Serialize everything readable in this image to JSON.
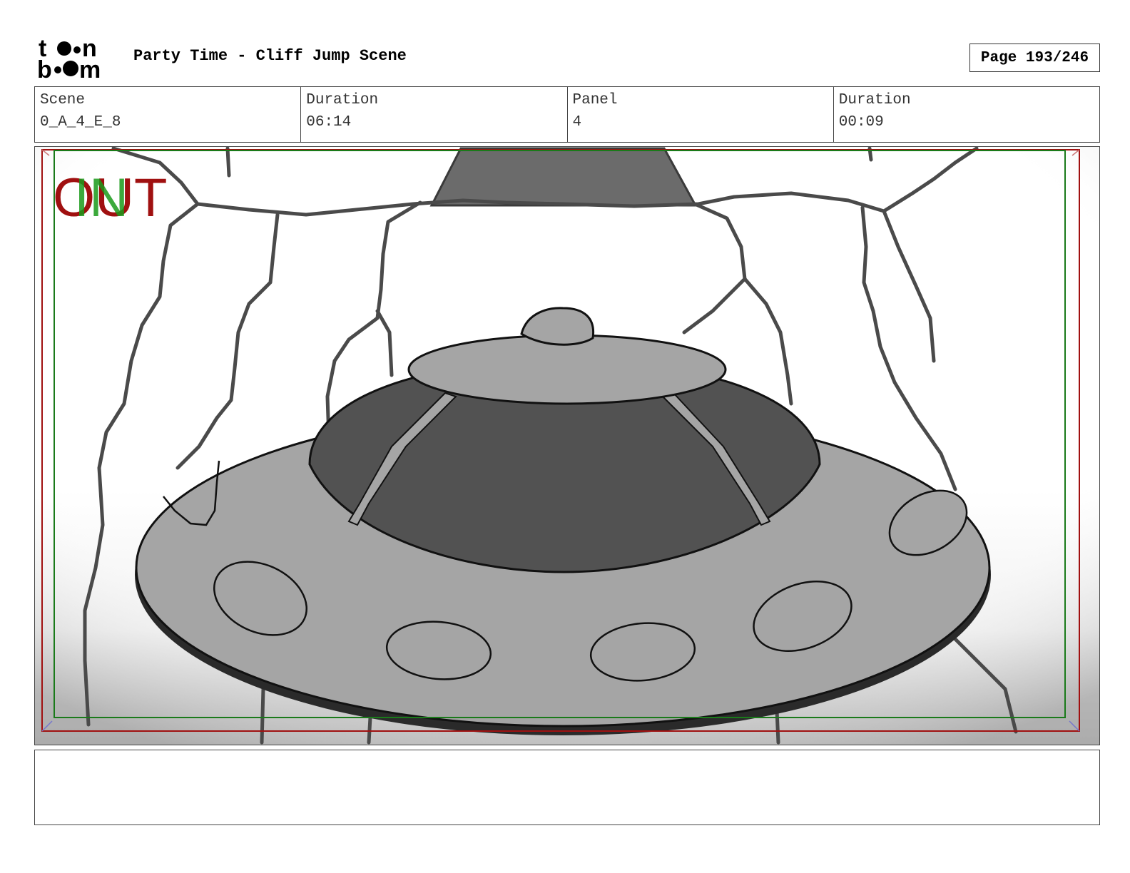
{
  "header": {
    "logo_top": "t",
    "logo_top_end": "n",
    "logo_bottom_start": "b",
    "logo_bottom_end": "m",
    "title": "Party Time - Cliff Jump Scene",
    "page": "Page 193/246"
  },
  "info": {
    "scene_label": "Scene",
    "scene_value": "0_A_4_E_8",
    "scene_duration_label": "Duration",
    "scene_duration_value": "06:14",
    "panel_label": "Panel",
    "panel_value": "4",
    "panel_duration_label": "Duration",
    "panel_duration_value": "00:09"
  },
  "panel": {
    "marker_out": "OUT",
    "marker_in": "IN",
    "colors": {
      "safe_frame_red": "#a01010",
      "safe_frame_green": "#1a7a1a",
      "ship_light": "#a5a5a5",
      "ship_dark": "#555555",
      "rock_line": "#4a4a4a"
    }
  },
  "notes": {
    "text": ""
  }
}
